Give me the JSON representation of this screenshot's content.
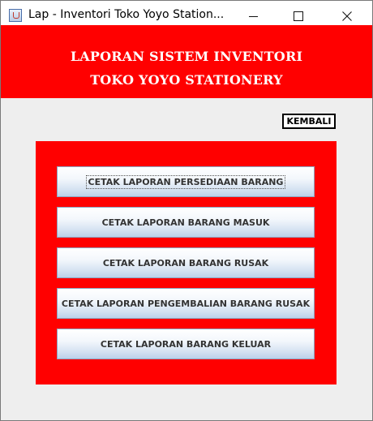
{
  "window": {
    "title": "Lap - Inventori Toko Yoyo Station...",
    "icon": "java-cup-icon"
  },
  "header": {
    "line1": "LAPORAN SISTEM INVENTORI",
    "line2": "TOKO YOYO STATIONERY",
    "background": "#ff0000"
  },
  "kembali_label": "KEMBALI",
  "panel": {
    "background": "#ff0000",
    "buttons": [
      {
        "label": "CETAK LAPORAN PERSEDIAAN BARANG",
        "focused": true
      },
      {
        "label": "CETAK LAPORAN BARANG MASUK",
        "focused": false
      },
      {
        "label": "CETAK LAPORAN BARANG RUSAK",
        "focused": false
      },
      {
        "label": "CETAK LAPORAN PENGEMBALIAN BARANG RUSAK",
        "focused": false
      },
      {
        "label": "CETAK LAPORAN BARANG KELUAR",
        "focused": false
      }
    ]
  }
}
